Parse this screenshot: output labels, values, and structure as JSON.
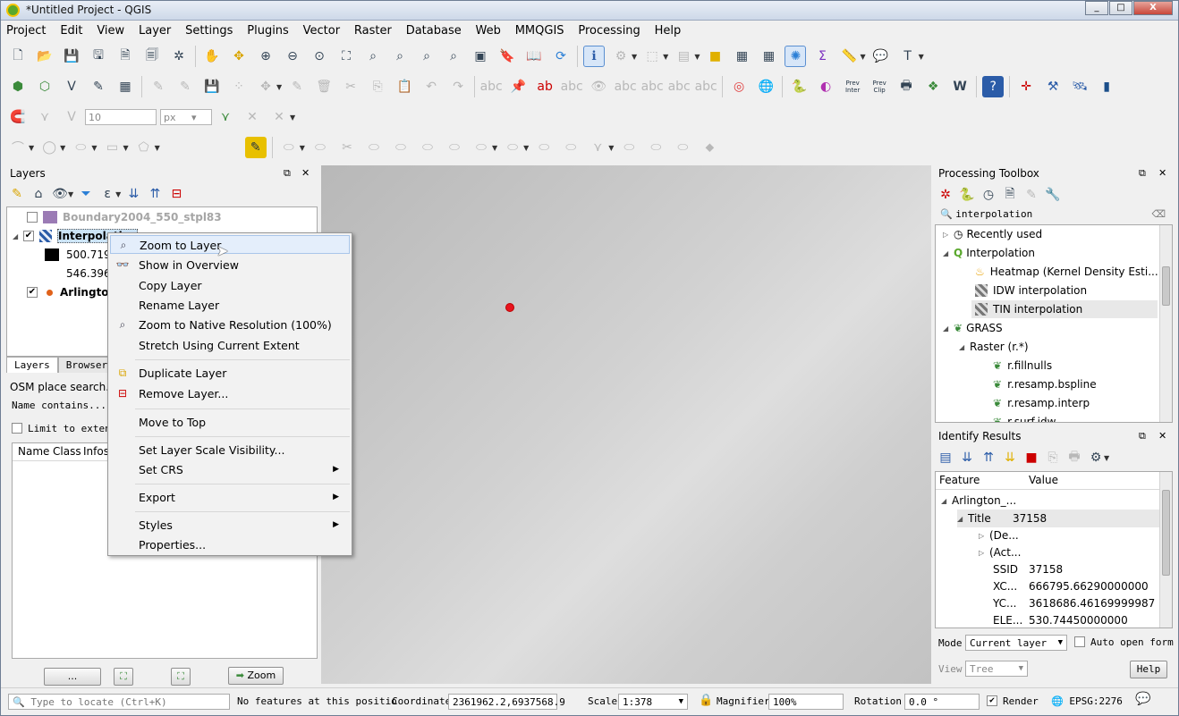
{
  "window": {
    "title": "*Untitled Project - QGIS",
    "minimize": "_",
    "maximize": "□",
    "close": "X"
  },
  "menu": [
    "Project",
    "Edit",
    "View",
    "Layer",
    "Settings",
    "Plugins",
    "Vector",
    "Raster",
    "Database",
    "Web",
    "MMQGIS",
    "Processing",
    "Help"
  ],
  "digitize": {
    "size_value": "10",
    "unit": "px"
  },
  "toolbar_text": {
    "prev_inter_line1": "Prev",
    "prev_inter_line2": "Inter",
    "prev_clip_line1": "Prev",
    "prev_clip_line2": "Clip"
  },
  "layers_panel": {
    "title": "Layers",
    "layers": [
      {
        "name": "Boundary2004_550_stpl83",
        "checked": false,
        "greyed": true
      },
      {
        "name": "Interpolation",
        "checked": true,
        "bold": true,
        "legend": [
          {
            "value": "500.719",
            "color": "#000000"
          },
          {
            "value": "546.396",
            "color": "#ffffff"
          }
        ]
      },
      {
        "name": "Arlington",
        "checked": true,
        "bold": true
      }
    ],
    "tabs": [
      "Layers",
      "Browser"
    ]
  },
  "osm_panel": {
    "title": "OSM place search...",
    "name_contains": "Name contains...",
    "limit_checkbox": "Limit to extent",
    "columns": [
      "Name",
      "Class",
      "Infos"
    ],
    "buttons": {
      "more": "...",
      "zoom": "Zoom"
    }
  },
  "context_menu": {
    "items": [
      {
        "label": "Zoom to Layer",
        "icon": "zoom-layer-icon",
        "highlight": true
      },
      {
        "label": "Show in Overview",
        "icon": "glasses-icon"
      },
      {
        "label": "Copy Layer"
      },
      {
        "label": "Rename Layer"
      },
      {
        "label": "Zoom to Native Resolution (100%)",
        "icon": "zoom-native-icon"
      },
      {
        "label": "Stretch Using Current Extent"
      },
      {
        "label": "Duplicate Layer",
        "icon": "duplicate-icon"
      },
      {
        "label": "Remove Layer...",
        "icon": "remove-layer-icon"
      },
      {
        "label": "Move to Top"
      },
      {
        "label": "Set Layer Scale Visibility..."
      },
      {
        "label": "Set CRS",
        "submenu": true
      },
      {
        "label": "Export",
        "submenu": true
      },
      {
        "label": "Styles",
        "submenu": true
      },
      {
        "label": "Properties..."
      }
    ]
  },
  "processing": {
    "title": "Processing Toolbox",
    "search_value": "interpolation",
    "tree": [
      {
        "label": "Recently used",
        "level": 0,
        "expand": "closed"
      },
      {
        "label": "Interpolation",
        "level": 0,
        "expand": "open"
      },
      {
        "label": "Heatmap (Kernel Density Esti...",
        "level": 1
      },
      {
        "label": "IDW interpolation",
        "level": 1
      },
      {
        "label": "TIN interpolation",
        "level": 1,
        "selected": true
      },
      {
        "label": "GRASS",
        "level": 0,
        "expand": "open"
      },
      {
        "label": "Raster (r.*)",
        "level": 1,
        "expand": "open"
      },
      {
        "label": "r.fillnulls",
        "level": 2
      },
      {
        "label": "r.resamp.bspline",
        "level": 2
      },
      {
        "label": "r.resamp.interp",
        "level": 2
      },
      {
        "label": "r.surf.idw",
        "level": 2
      }
    ]
  },
  "identify": {
    "title": "Identify Results",
    "columns": [
      "Feature",
      "Value"
    ],
    "rows": [
      {
        "feature": "Arlington_...",
        "value": "",
        "level": 0,
        "expand": "open"
      },
      {
        "feature": "Title",
        "value": "37158",
        "level": 1,
        "expand": "open",
        "selected": true
      },
      {
        "feature": "(De...",
        "value": "",
        "level": 2,
        "expand": "closed"
      },
      {
        "feature": "(Act...",
        "value": "",
        "level": 2,
        "expand": "closed"
      },
      {
        "feature": "SSID",
        "value": "37158",
        "level": 2
      },
      {
        "feature": "XC...",
        "value": "666795.66290000000",
        "level": 2
      },
      {
        "feature": "YC...",
        "value": "3618686.46169999987",
        "level": 2
      },
      {
        "feature": "ELE...",
        "value": "530.74450000000",
        "level": 2
      }
    ],
    "mode_label": "Mode",
    "mode_value": "Current layer",
    "auto_open": "Auto open form",
    "view_label": "View",
    "view_value": "Tree",
    "help": "Help"
  },
  "status": {
    "locate_placeholder": "Type to locate (Ctrl+K)",
    "message": "No features at this positio",
    "coordinate_label": "Coordinate",
    "coordinate_value": "2361962.2,6937568.9",
    "scale_label": "Scale",
    "scale_value": "1:378",
    "magnifier_label": "Magnifier",
    "magnifier_value": "100%",
    "rotation_label": "Rotation",
    "rotation_value": "0.0 °",
    "render_label": "Render",
    "crs": "EPSG:2276"
  },
  "colors": {
    "selection": "#cce4f7",
    "menu_highlight": "#e4eefb",
    "point": "#e8141e"
  }
}
